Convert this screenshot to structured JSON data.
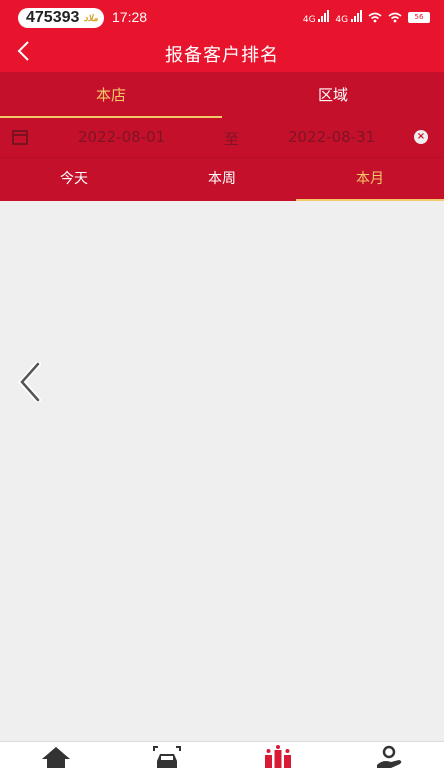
{
  "status_bar": {
    "badge_number": "475393",
    "badge_brand": "ملاد",
    "time": "17:28",
    "signal1": "4G",
    "signal2": "4G",
    "wifi_icon": "wifi-icon",
    "battery": "56"
  },
  "header": {
    "back_icon": "back-arrow-icon",
    "title": "报备客户排名"
  },
  "scope_tabs": [
    {
      "label": "本店",
      "active": true
    },
    {
      "label": "区域",
      "active": false
    }
  ],
  "date_filter": {
    "calendar_icon": "calendar-icon",
    "start": "2022-08-01",
    "separator": "至",
    "end": "2022-08-31",
    "clear_icon": "clear-icon"
  },
  "period_tabs": [
    {
      "label": "今天",
      "active": false
    },
    {
      "label": "本周",
      "active": false
    },
    {
      "label": "本月",
      "active": true
    }
  ],
  "bottom_nav": [
    {
      "icon": "home-icon"
    },
    {
      "icon": "car-scan-icon"
    },
    {
      "icon": "ranking-icon"
    },
    {
      "icon": "customer-hand-icon"
    }
  ],
  "colors": {
    "brand_red": "#e8132d",
    "tab_red": "#c5102c",
    "active_gold": "#f3c96a"
  }
}
